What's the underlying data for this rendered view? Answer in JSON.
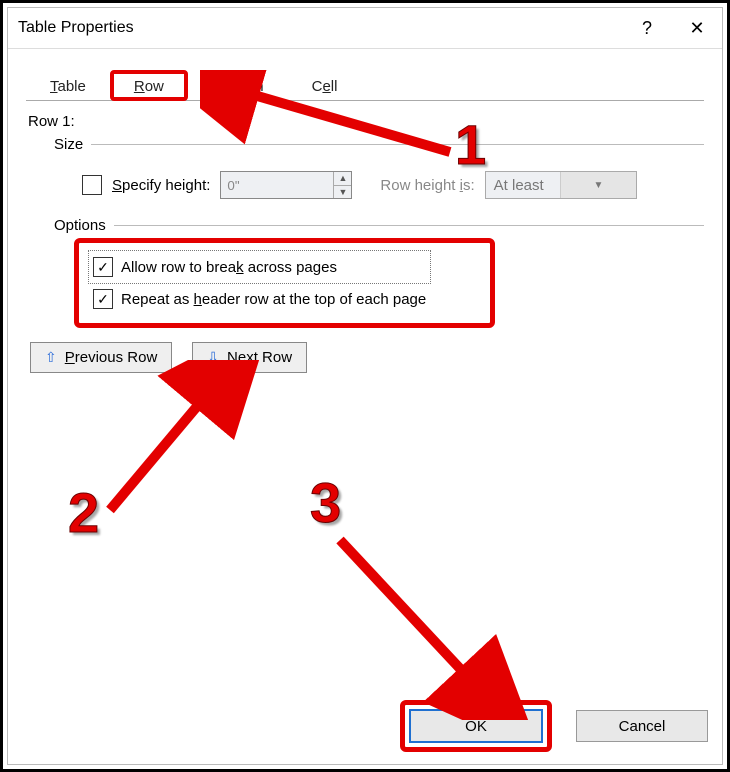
{
  "title": "Table Properties",
  "help_glyph": "?",
  "close_glyph": "✕",
  "tabs": {
    "table": "Table",
    "row": "Row",
    "column": "Column",
    "cell": "Cell"
  },
  "row_header": "Row 1:",
  "size_label": "Size",
  "specify_height_label": "Specify height:",
  "height_value": "0\"",
  "row_height_is_label": "Row height is:",
  "row_height_mode": "At least",
  "options_label": "Options",
  "opt_allow_break": "Allow row to break across pages",
  "opt_repeat_header": "Repeat as header row at the top of each page",
  "prev_row_label": "Previous Row",
  "next_row_label": "Next Row",
  "ok_label": "OK",
  "cancel_label": "Cancel",
  "annotations": {
    "n1": "1",
    "n2": "2",
    "n3": "3"
  },
  "checks": {
    "allow_break": "✓",
    "repeat_header": "✓"
  }
}
